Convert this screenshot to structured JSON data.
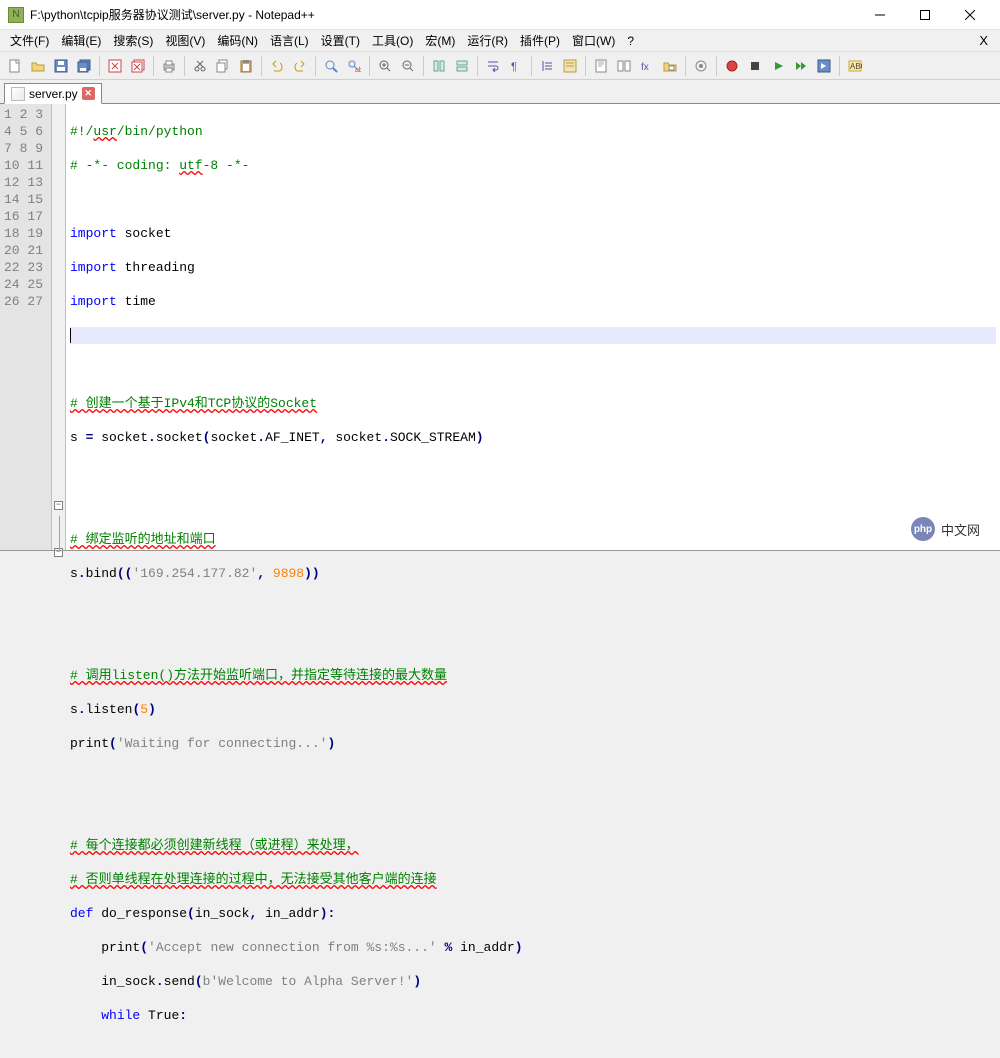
{
  "window": {
    "title": "F:\\python\\tcpip服务器协议测试\\server.py - Notepad++"
  },
  "menu": {
    "file": "文件(F)",
    "edit": "编辑(E)",
    "search": "搜索(S)",
    "view": "视图(V)",
    "encoding": "编码(N)",
    "language": "语言(L)",
    "settings": "设置(T)",
    "tools": "工具(O)",
    "macro": "宏(M)",
    "run": "运行(R)",
    "plugins": "插件(P)",
    "window": "窗口(W)",
    "help": "?"
  },
  "tab": {
    "filename": "server.py"
  },
  "gutter": {
    "start": 1,
    "end": 27
  },
  "code": {
    "l1a": "#!/",
    "l1b": "usr",
    "l1c": "/bin/python",
    "l2a": "# -*- coding: ",
    "l2b": "utf",
    "l2c": "-8 -*-",
    "l4a": "import",
    "l4b": " socket",
    "l5a": "import",
    "l5b": " threading",
    "l6a": "import",
    "l6b": " time",
    "l9": "# 创建一个基于IPv4和TCP协议的Socket",
    "l10a": "s ",
    "l10b": "=",
    "l10c": " socket",
    "l10d": ".",
    "l10e": "socket",
    "l10f": "(",
    "l10g": "socket",
    "l10h": ".",
    "l10i": "AF_INET",
    "l10j": ",",
    "l10k": " socket",
    "l10l": ".",
    "l10m": "SOCK_STREAM",
    "l10n": ")",
    "l13": "# 绑定监听的地址和端口",
    "l14a": "s",
    "l14b": ".",
    "l14c": "bind",
    "l14d": "((",
    "l14e": "'169.254.177.82'",
    "l14f": ",",
    "l14g": " ",
    "l14h": "9898",
    "l14i": "))",
    "l17": "# 调用listen()方法开始监听端口，并指定等待连接的最大数量",
    "l18a": "s",
    "l18b": ".",
    "l18c": "listen",
    "l18d": "(",
    "l18e": "5",
    "l18f": ")",
    "l19a": "print",
    "l19b": "(",
    "l19c": "'Waiting for connecting...'",
    "l19d": ")",
    "l22": "# 每个连接都必须创建新线程（或进程）来处理，",
    "l23": "# 否则单线程在处理连接的过程中，无法接受其他客户端的连接",
    "l24a": "def",
    "l24b": " ",
    "l24c": "do_response",
    "l24d": "(",
    "l24e": "in_sock",
    "l24f": ",",
    "l24g": " in_addr",
    "l24h": "):",
    "l25a": "    ",
    "l25b": "print",
    "l25c": "(",
    "l25d": "'Accept new connection from %s:%s...'",
    "l25e": " ",
    "l25f": "%",
    "l25g": " in_addr",
    "l25h": ")",
    "l26a": "    in_sock",
    "l26b": ".",
    "l26c": "send",
    "l26d": "(",
    "l26e": "b'Welcome to Alpha Server!'",
    "l26f": ")",
    "l27a": "    ",
    "l27b": "while",
    "l27c": " True",
    "l27d": ":"
  },
  "watermark": {
    "logo": "php",
    "text": "中文网"
  }
}
